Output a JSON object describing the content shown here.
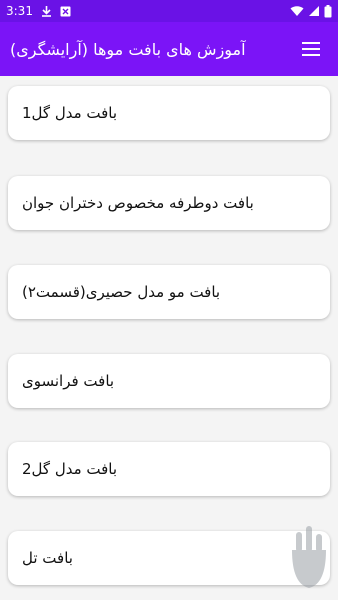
{
  "status_bar": {
    "time": "3:31",
    "icons": [
      "download-icon",
      "store-icon",
      "wifi-icon",
      "cellular-icon",
      "battery-icon"
    ]
  },
  "app_bar": {
    "title": "آموزش های بافت موها (آرایشگری)",
    "menu_icon": "hamburger-menu-icon"
  },
  "list": {
    "items": [
      {
        "label": "بافت مدل گل1"
      },
      {
        "label": "بافت دوطرفه مخصوص دختران جوان"
      },
      {
        "label": "بافت مو مدل حصیری(قسمت۲)"
      },
      {
        "label": "بافت فرانسوی"
      },
      {
        "label": "بافت مدل گل2"
      },
      {
        "label": "بافت تل"
      }
    ]
  },
  "colors": {
    "status_bar": "#6a12e6",
    "app_bar": "#7b14f7",
    "background": "#f4f4f4",
    "card": "#ffffff"
  }
}
